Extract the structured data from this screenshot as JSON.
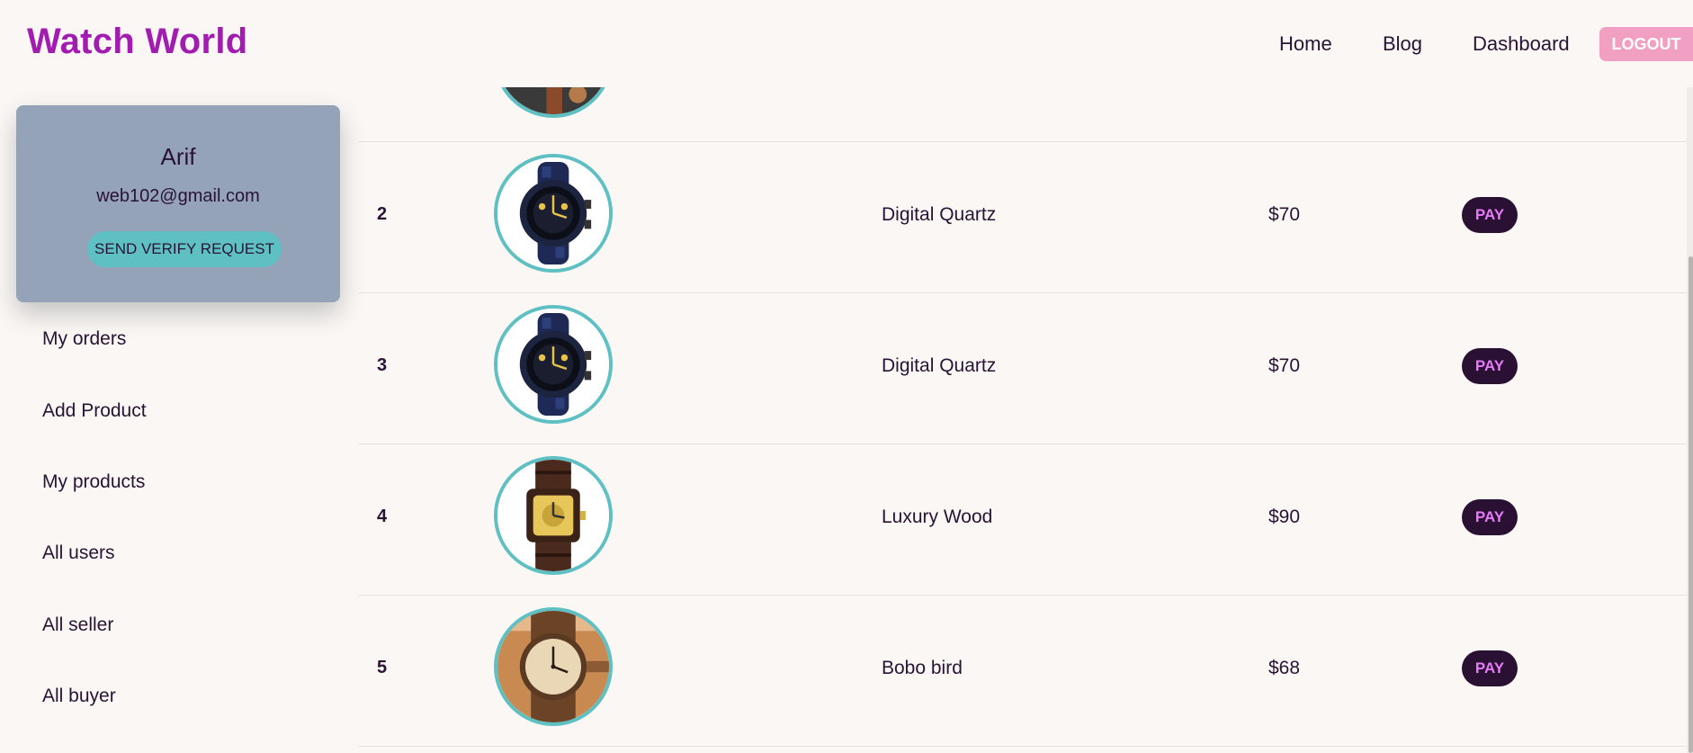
{
  "brand": "Watch World",
  "nav": {
    "home": "Home",
    "blog": "Blog",
    "dashboard": "Dashboard",
    "logout": "LOGOUT"
  },
  "profile": {
    "name": "Arif",
    "email": "web102@gmail.com",
    "verify_label": "SEND VERIFY REQUEST"
  },
  "menu": [
    "My orders",
    "Add Product",
    "My products",
    "All users",
    "All seller",
    "All buyer"
  ],
  "orders": [
    {
      "num": "2",
      "name": "Digital Quartz",
      "price": "$70",
      "action": "PAY",
      "image": "digital-quartz-watch-icon"
    },
    {
      "num": "3",
      "name": "Digital Quartz",
      "price": "$70",
      "action": "PAY",
      "image": "digital-quartz-watch-icon"
    },
    {
      "num": "4",
      "name": "Luxury Wood",
      "price": "$90",
      "action": "PAY",
      "image": "luxury-wood-watch-icon"
    },
    {
      "num": "5",
      "name": "Bobo bird",
      "price": "$68",
      "action": "PAY",
      "image": "bobo-bird-watch-icon"
    }
  ],
  "colors": {
    "brand": "#a21caf",
    "card": "#94a3b8",
    "accent": "#5fc0c3",
    "pay_bg": "#2a1134",
    "pay_text": "#e879f9",
    "logout_bg": "#f29fc4"
  }
}
